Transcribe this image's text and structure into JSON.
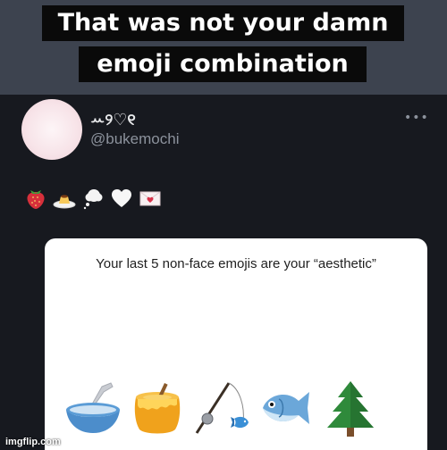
{
  "meme": {
    "caption_line1": "That was not your damn",
    "caption_line2": "emoji combination"
  },
  "tweet": {
    "display_name": "ꕀ୨♡୧",
    "handle": "@bukemochi",
    "more_label": "•••",
    "emojis": [
      "strawberry-icon",
      "custard-pudding-icon",
      "thought-bubble-icon",
      "white-heart-icon",
      "love-letter-icon"
    ]
  },
  "card": {
    "caption": "Your last 5 non-face emojis are your “aesthetic”",
    "emojis": [
      "bowl-with-spoon-icon",
      "honey-pot-icon",
      "fishing-pole-icon",
      "fish-icon",
      "evergreen-tree-icon"
    ]
  },
  "watermark": "imgflip.com",
  "colors": {
    "background": "#15171d",
    "caption_band": "#3d434f",
    "card": "#ffffff"
  }
}
